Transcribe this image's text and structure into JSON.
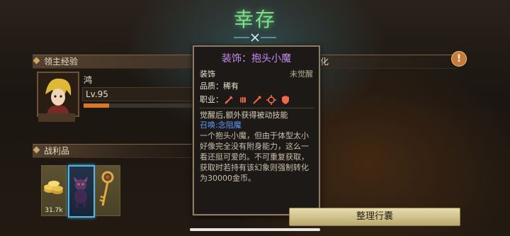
{
  "title": "幸存",
  "lord_section": {
    "label": "领主经验",
    "suffix": "变化",
    "player_name": "鸿",
    "level": "Lv.95",
    "xp_fraction": 0.23
  },
  "loot_section": {
    "label": "战利品",
    "items": [
      {
        "icon": "gold-coins-icon",
        "count": "31.7k"
      },
      {
        "icon": "imp-figure-icon",
        "count": ""
      },
      {
        "icon": "ornate-key-icon",
        "count": ""
      }
    ]
  },
  "tooltip": {
    "title": "装饰：抱头小魔",
    "type_label": "装饰",
    "awaken_status": "未觉醒",
    "quality": "品质：稀有",
    "job_label": "职业：",
    "jobs": [
      "sword-icon",
      "fist-icon",
      "wand-icon",
      "crosshair-icon",
      "shield-icon"
    ],
    "effect_intro": "觉醒后,额外获得被动技能",
    "skill_name": "召唤:念阻魔",
    "description": "一个抱头小魔，但由于体型太小好像完全没有附身能力，这么一看还挺可爱的。不可重复获取，获取时若持有该幻象则强制转化为30000金币。"
  },
  "buttons": {
    "sort_bag": "整理行囊"
  },
  "alert_icon": "exclamation-icon",
  "colors": {
    "title": "#7fe08a",
    "tooltip_title": "#c58cf0",
    "skill_name": "#5a9cff",
    "xp_fill": "#d8782a",
    "selected_border": "#4fb6e6"
  }
}
